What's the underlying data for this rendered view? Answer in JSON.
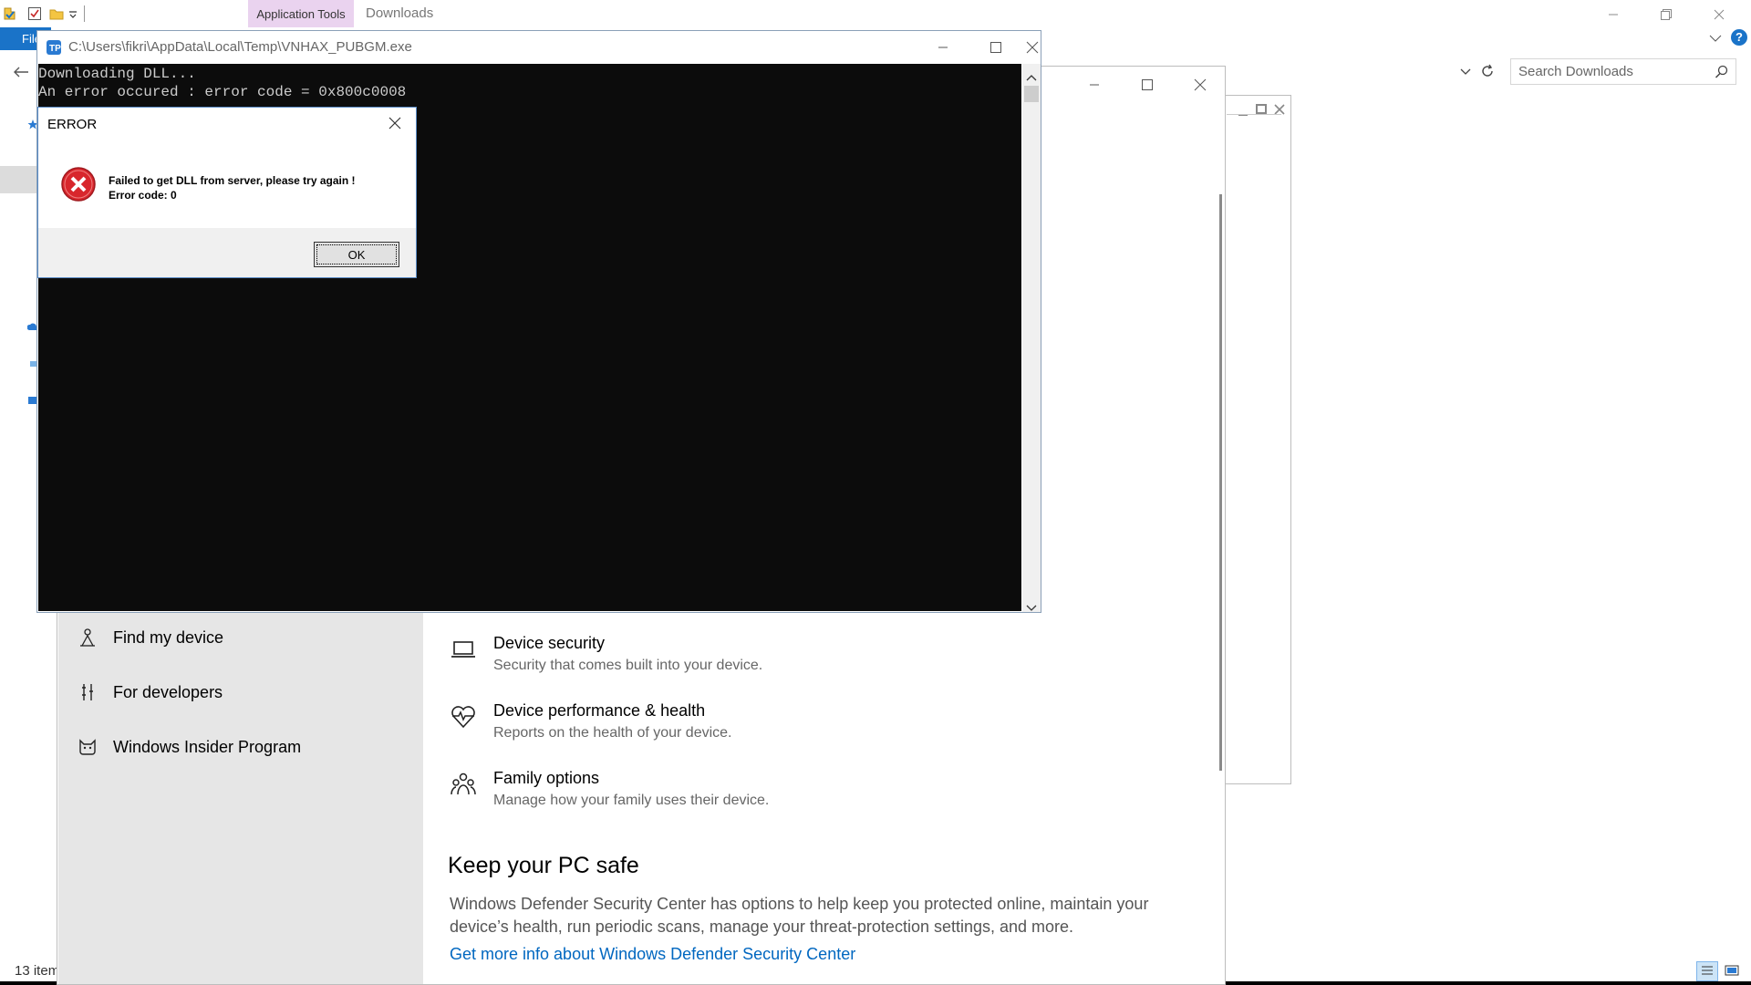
{
  "explorer": {
    "ribbon_context_tab": "Application Tools",
    "title": "Downloads",
    "file_tab": "File",
    "search_placeholder": "Search Downloads",
    "status_items": "13 item"
  },
  "settings": {
    "nav_items": [
      {
        "label": "Find my device",
        "icon": "person-pin-icon"
      },
      {
        "label": "For developers",
        "icon": "developer-tools-icon"
      },
      {
        "label": "Windows Insider Program",
        "icon": "cat-icon"
      }
    ],
    "features": [
      {
        "title": "Device security",
        "desc": "Security that comes built into your device.",
        "icon": "laptop-icon"
      },
      {
        "title": "Device performance & health",
        "desc": "Reports on the health of your device.",
        "icon": "heart-pulse-icon"
      },
      {
        "title": "Family options",
        "desc": "Manage how your family uses their device.",
        "icon": "family-icon"
      }
    ],
    "keep_safe_heading": "Keep your PC safe",
    "keep_safe_text": "Windows Defender Security Center has options to help keep you protected online, maintain your device’s health, run periodic scans, manage your threat-protection settings, and more.",
    "keep_safe_link": "Get more info about Windows Defender Security Center",
    "link_color": "#0067c0"
  },
  "console": {
    "title": "C:\\Users\\fikri\\AppData\\Local\\Temp\\VNHAX_PUBGM.exe",
    "lines": [
      "Downloading DLL...",
      "An error occured : error code = 0x800c0008"
    ]
  },
  "error_dialog": {
    "title": "ERROR",
    "message_line1": "Failed to get DLL from server, please try again !",
    "message_line2": "Error code: 0",
    "ok_label": "OK",
    "icon": "error-x-icon"
  },
  "colors": {
    "ribbon_file": "#1a73c8",
    "context_tab": "#ead3ef",
    "console_bg": "#0c0c0c",
    "settings_nav_bg": "#e6e6e6",
    "error_red": "#d8262c"
  }
}
